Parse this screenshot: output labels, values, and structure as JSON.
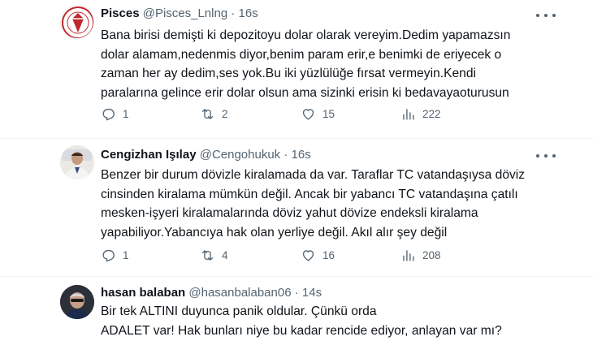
{
  "tweets": [
    {
      "name": "Pisces",
      "handle": "@Pisces_Lnlng",
      "time": "16s",
      "lines": [
        "Bana birisi demişti ki depozitoyu dolar olarak vereyim.Dedim yapamazsın",
        "dolar alamam,nedenmis diyor,benim param erir,e benimki de eriyecek o",
        "zaman her ay dedim,ses yok.Bu iki yüzlülüğe fırsat vermeyin.Kendi",
        "paralarına gelince erir dolar olsun ama sizinki erisin ki bedavayaoturusun"
      ],
      "replies": "1",
      "retweets": "2",
      "likes": "15",
      "views": "222"
    },
    {
      "name": "Cengizhan Işılay",
      "handle": "@Cengohukuk",
      "time": "16s",
      "lines": [
        "Benzer bir durum dövizle kiralamada da var. Taraflar TC vatandaşıysa döviz",
        "cinsinden kiralama mümkün değil. Ancak bir yabancı TC vatandaşına çatılı",
        "mesken-işyeri kiralamalarında döviz yahut dövize endeksli kiralama",
        "yapabiliyor.Yabancıya hak olan yerliye değil. Akıl alır şey değil"
      ],
      "replies": "1",
      "retweets": "4",
      "likes": "16",
      "views": "208"
    },
    {
      "name": "hasan balaban",
      "handle": "@hasanbalaban06",
      "time": "14s",
      "lines": [
        "Bir tek ALTINI duyunca panik oldular. Çünkü orda",
        "ADALET var! Hak bunları niye bu kadar rencide ediyor, anlayan var mı?"
      ]
    }
  ],
  "separator": "·"
}
